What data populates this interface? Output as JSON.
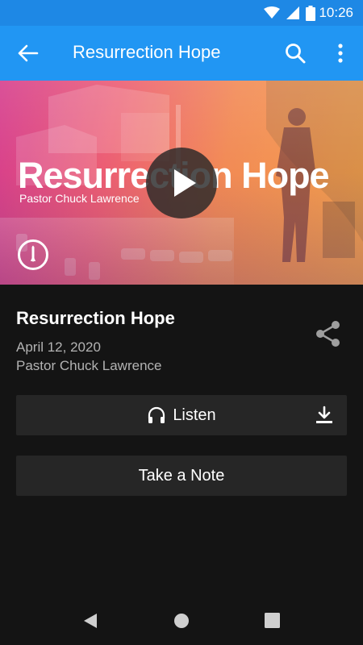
{
  "status_bar": {
    "time": "10:26",
    "icons": [
      "wifi-icon",
      "cell-signal-icon",
      "battery-icon"
    ]
  },
  "app_bar": {
    "title": "Resurrection Hope",
    "icons": [
      "back-arrow-icon",
      "search-icon",
      "more-vert-icon"
    ],
    "color": "#2196f3"
  },
  "hero": {
    "title": "Resurrection Hope",
    "subtitle": "Pastor Chuck Lawrence",
    "icons": [
      "play-icon",
      "church-logo-icon"
    ]
  },
  "sermon": {
    "title": "Resurrection Hope",
    "date": "April 12, 2020",
    "pastor": "Pastor Chuck Lawrence",
    "share_icon": "share-icon"
  },
  "actions": {
    "listen_label": "Listen",
    "listen_icon": "headphones-icon",
    "download_icon": "download-icon",
    "note_label": "Take a Note"
  },
  "nav_bar": {
    "icons": [
      "nav-back-icon",
      "nav-home-icon",
      "nav-recents-icon"
    ]
  },
  "colors": {
    "background": "#141414",
    "button_bg": "#262626",
    "status_bar": "#1e88e5"
  }
}
